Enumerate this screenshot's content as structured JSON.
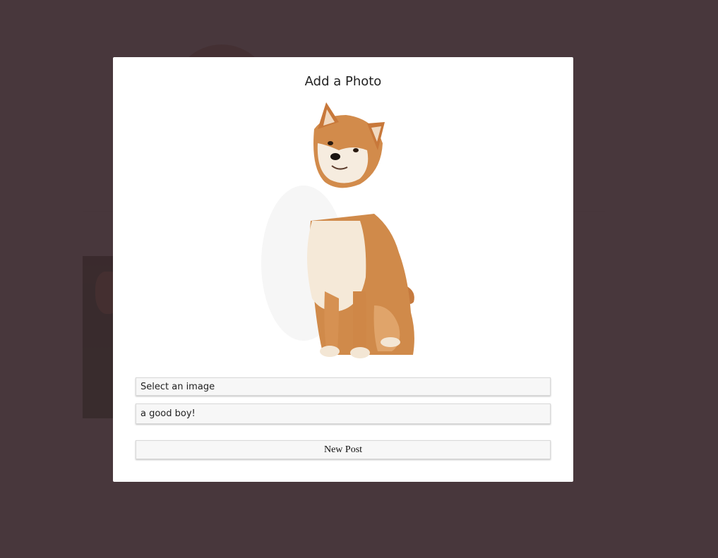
{
  "modal": {
    "title": "Add a Photo",
    "file_input_label": "Select an image",
    "caption_value": "a good boy!",
    "submit_label": "New Post"
  },
  "preview_image": {
    "subject": "shiba-inu-dog"
  },
  "colors": {
    "overlay": "#483a3d",
    "modal_bg": "#ffffff",
    "field_bg": "#f7f7f7"
  }
}
